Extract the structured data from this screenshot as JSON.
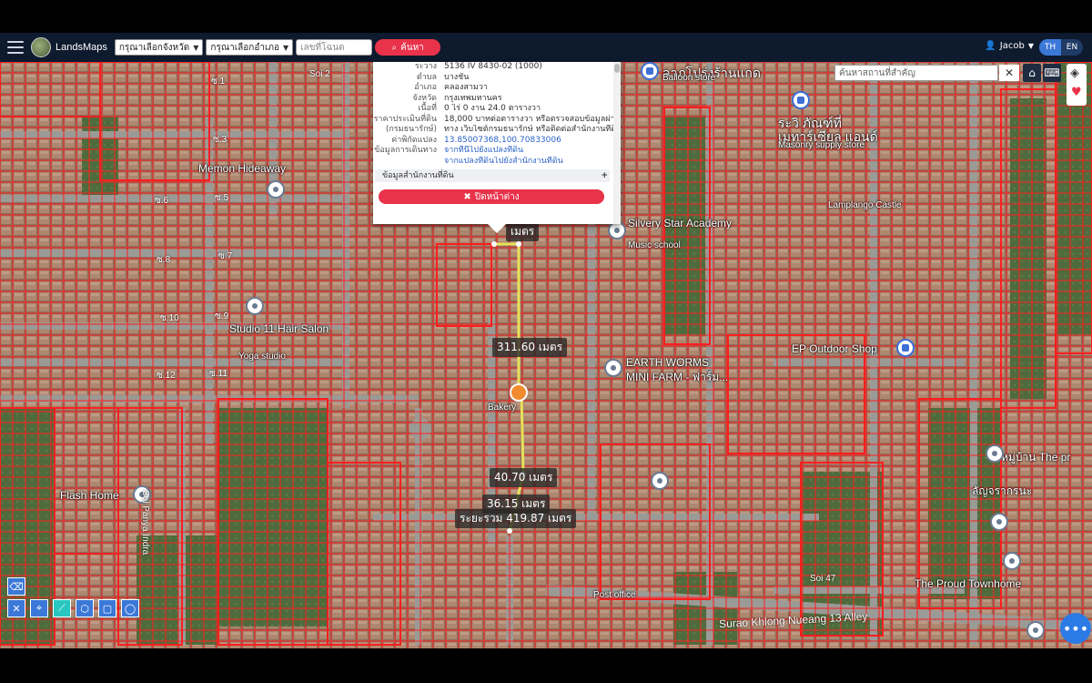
{
  "header": {
    "brand": "LandsMaps",
    "province_select": "กรุณาเลือกจังหวัด",
    "amphoe_select": "กรุณาเลือกอำเภอ",
    "deed_placeholder": "เลขที่โฉนด",
    "search_label": "ค้นหา",
    "user_name": "Jacob",
    "lang_th": "TH",
    "lang_en": "EN"
  },
  "popup": {
    "rows": [
      {
        "k": "ระวาง",
        "v": "5136 IV 8430-02 (1000)"
      },
      {
        "k": "ตำบล",
        "v": "บางชัน"
      },
      {
        "k": "อำเภอ",
        "v": "คลองสามวา"
      },
      {
        "k": "จังหวัด",
        "v": "กรุงเทพมหานคร"
      },
      {
        "k": "เนื้อที่",
        "v": "0 ไร่ 0 งาน 24.0 ตารางวา"
      },
      {
        "k": "ราคาประเมินที่ดิน",
        "v": "18,000 บาทต่อตารางวา หรือตรวจสอบข้อมูลผ่าน"
      },
      {
        "k": "(กรมธนารักษ์)",
        "v": "ทาง เว็บไซต์กรมธนารักษ์ หรือติดต่อสำนักงานที่ดิน"
      },
      {
        "k": "ค่าพิกัดแปลง",
        "v": "13.85007368,100.70833006"
      },
      {
        "k": "ข้อมูลการเดินทาง",
        "v": "จากที่นี่ไปยังแปลงที่ดิน"
      },
      {
        "k": "",
        "v": "จากแปลงที่ดินไปยังสำนักงานที่ดิน"
      }
    ],
    "section_label": "ข้อมูลสำนักงานที่ดิน",
    "close_label": "ปิดหน้าต่าง"
  },
  "place_search_placeholder": "ค้นหาสถานที่สำคัญ",
  "map": {
    "pois": [
      {
        "name": "ลาภโปร่งร้านแกด",
        "sub": "Balloon store"
      },
      {
        "name": "ระวิ ภัณฑ์ที่"
      },
      {
        "name": "เมทาร์เซียล แอนด์"
      },
      {
        "name": "Masonry supply store"
      },
      {
        "name": "Memon Hideaway"
      },
      {
        "name": "Silvery Star Academy"
      },
      {
        "name": "Music school"
      },
      {
        "name": "Studio 11 Hair Salon"
      },
      {
        "name": "Yoga studio"
      },
      {
        "name": "EARTH WORMS"
      },
      {
        "name": "MINI FARM - ฟาร์ม..."
      },
      {
        "name": "EP Outdoor Shop"
      },
      {
        "name": "Flash Home"
      },
      {
        "name": "Bakery"
      },
      {
        "name": "The Proud Townhome"
      },
      {
        "name": "Post office"
      },
      {
        "name": "Lamplango Castle"
      },
      {
        "name": "หมู่บ้าน The pr"
      },
      {
        "name": "ลัญจรากรนะ"
      }
    ],
    "roads": [
      {
        "name": "Soi 2"
      },
      {
        "name": "ซ.1"
      },
      {
        "name": "ซ.3"
      },
      {
        "name": "ซ.5"
      },
      {
        "name": "ซ.6"
      },
      {
        "name": "ซ.7"
      },
      {
        "name": "ซ.8"
      },
      {
        "name": "ซ.9"
      },
      {
        "name": "ซ.10"
      },
      {
        "name": "ซ.11"
      },
      {
        "name": "ซ.12"
      },
      {
        "name": "Soi 47"
      },
      {
        "name": "Surao Khlong Nueang 13 Alley"
      },
      {
        "name": "Soi Panya Indra"
      }
    ],
    "measurements": [
      {
        "label": "311.60 เมตร"
      },
      {
        "label": "40.70 เมตร"
      },
      {
        "label": "36.15 เมตร"
      },
      {
        "label": "ระยะรวม 419.87 เมตร"
      },
      {
        "label": "เมตร"
      }
    ]
  },
  "colors": {
    "parcel_line": "#ff1e1e",
    "measure_line": "#e6e35a",
    "header_bg": "#0e1a2e",
    "accent_red": "#e8334a",
    "accent_blue": "#3b78d8"
  }
}
